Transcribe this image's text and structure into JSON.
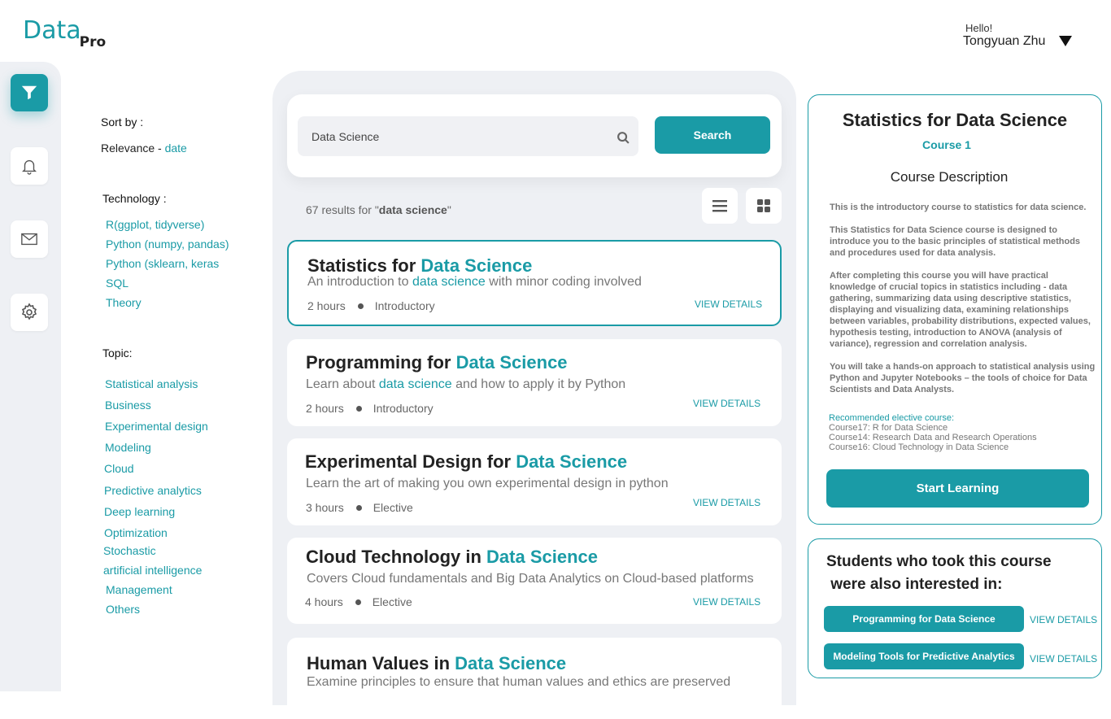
{
  "logo": {
    "main": "Data",
    "sub": "Pro"
  },
  "user": {
    "greeting": "Hello!",
    "name": "Tongyuan Zhu"
  },
  "colors": {
    "accent": "#1a9ba6",
    "panel_bg": "#eef0f4"
  },
  "rail": {
    "icons": [
      "filter-icon",
      "bell-icon",
      "mail-icon",
      "gear-icon"
    ]
  },
  "filters": {
    "sort_label": "Sort by :",
    "sort_relevance": "Relevance - ",
    "sort_date": "date",
    "technology_label": "Technology :",
    "technology": [
      "R(ggplot, tidyverse)",
      "Python (numpy, pandas)",
      "Python (sklearn, keras",
      "SQL",
      "Theory"
    ],
    "topic_label": "Topic:",
    "topics": [
      "Statistical analysis",
      "Business",
      "Experimental design",
      "Modeling",
      "Cloud",
      "Predictive analytics",
      "Deep learning",
      "Optimization",
      "Stochastic",
      "artificial intelligence",
      "Management",
      "Others"
    ]
  },
  "search": {
    "value": "Data Science",
    "button_label": "Search"
  },
  "results": {
    "count": "67",
    "mid_text": " results for \"",
    "query": "data science",
    "end": "\""
  },
  "courses": [
    {
      "title_prefix": "Statistics for ",
      "title_accent": "Data Science",
      "desc_prefix": "An introduction to ",
      "desc_accent": "data science",
      "desc_suffix": " with minor coding involved",
      "hours": "2 hours",
      "level": "Introductory",
      "view": "VIEW DETAILS"
    },
    {
      "title_prefix": "Programming for ",
      "title_accent": "Data Science",
      "desc_prefix": "Learn about ",
      "desc_accent": "data science",
      "desc_suffix": " and how to apply it by Python",
      "hours": "2 hours",
      "level": "Introductory",
      "view": "VIEW DETAILS"
    },
    {
      "title_prefix": "Experimental Design for ",
      "title_accent": "Data Science",
      "desc_prefix": "Learn the art of making you own experimental design in python",
      "desc_accent": "",
      "desc_suffix": "",
      "hours": "3 hours",
      "level": "Elective",
      "view": "VIEW DETAILS"
    },
    {
      "title_prefix": "Cloud Technology in ",
      "title_accent": "Data Science",
      "desc_prefix": "Covers Cloud fundamentals and Big Data Analytics on Cloud-based platforms",
      "desc_accent": "",
      "desc_suffix": "",
      "hours": "4 hours",
      "level": "Elective",
      "view": "VIEW DETAILS"
    },
    {
      "title_prefix": "Human Values in ",
      "title_accent": "Data Science",
      "desc_prefix": "Examine principles to ensure that human values and ethics are preserved",
      "desc_accent": "",
      "desc_suffix": "",
      "hours": "",
      "level": "",
      "view": ""
    }
  ],
  "detail": {
    "title": "Statistics for Data Science",
    "course_num": "Course 1",
    "desc_heading": "Course Description",
    "para1": "This is the introductory course to statistics for data science.",
    "para2": "This Statistics for Data Science course is designed to introduce you to the basic principles of statistical methods and procedures used for data analysis.",
    "para3": "After completing this course you will have practical knowledge of crucial topics in statistics including - data gathering, summarizing data using descriptive statistics, displaying and visualizing data, examining relationships between variables, probability distributions, expected values, hypothesis testing, introduction to ANOVA (analysis of variance), regression and correlation analysis.",
    "para4": "You will take a hands-on approach to statistical analysis using Python and Jupyter Notebooks – the tools of choice for Data Scientists and Data Analysts.",
    "rec_heading": "Recommended elective course:",
    "rec": [
      "Course17: R for Data Science",
      "Course14: Research Data and Research Operations",
      "Course16: Cloud Technology in Data Science"
    ],
    "start_label": "Start Learning"
  },
  "also": {
    "heading_line1": "Students who took this course",
    "heading_line2": " were also interested in:",
    "items": [
      {
        "label": "Programming for Data Science",
        "view": "VIEW DETAILS"
      },
      {
        "label": "Modeling Tools for Predictive Analytics",
        "view": "VIEW DETAILS"
      }
    ]
  }
}
